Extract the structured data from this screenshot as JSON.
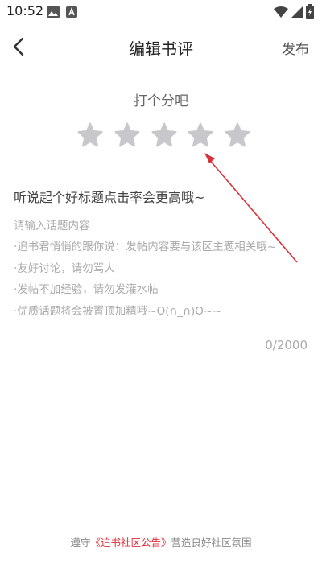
{
  "status_bar": {
    "time": "10:52",
    "icons": [
      "image-icon",
      "app-a-icon",
      "wifi-icon",
      "signal-icon",
      "battery-charging-icon"
    ]
  },
  "header": {
    "title": "编辑书评",
    "publish_label": "发布",
    "back_icon": "chevron-left-icon"
  },
  "rating": {
    "prompt": "打个分吧",
    "max": 5,
    "value": 0,
    "star_color": "#c8c7cc"
  },
  "topic": {
    "title_placeholder": "听说起个好标题点击率会更高哦~"
  },
  "content": {
    "placeholder_lines": [
      "请输入话题内容",
      "·追书君悄悄的跟你说：发帖内容要与该区主题相关哦~",
      "·友好讨论，请勿骂人",
      " ·发帖不加经验，请勿发灌水帖",
      "·优质话题将会被置顶加精哦~O(∩_∩)O~~"
    ],
    "counter": "0/2000"
  },
  "footer": {
    "prefix": "遵守",
    "link": "《追书社区公告》",
    "suffix": "营造良好社区氛围",
    "link_color": "#e0303a"
  },
  "annotation": {
    "arrow_color": "#d9313a"
  }
}
